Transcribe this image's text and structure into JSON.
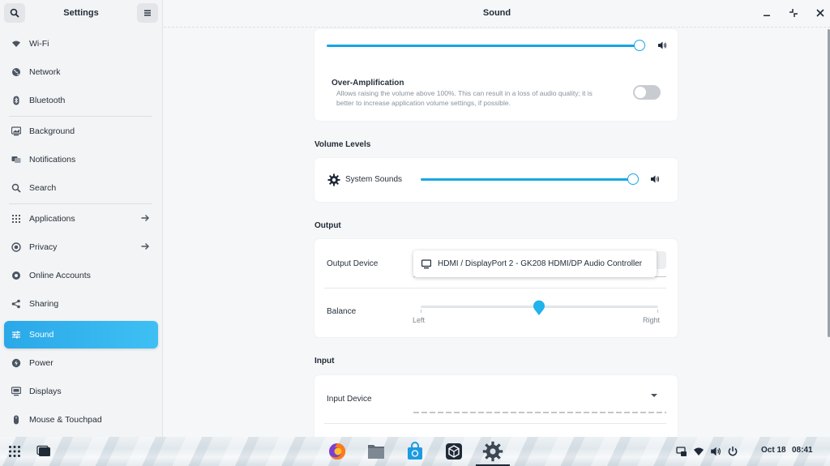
{
  "sidebar": {
    "title": "Settings",
    "items": [
      {
        "label": "Wi-Fi",
        "icon": "wifi-icon"
      },
      {
        "label": "Network",
        "icon": "network-icon"
      },
      {
        "label": "Bluetooth",
        "icon": "bluetooth-icon"
      },
      {
        "label": "Background",
        "icon": "background-icon"
      },
      {
        "label": "Notifications",
        "icon": "notifications-icon"
      },
      {
        "label": "Search",
        "icon": "search-icon"
      },
      {
        "label": "Applications",
        "icon": "applications-icon"
      },
      {
        "label": "Privacy",
        "icon": "privacy-icon"
      },
      {
        "label": "Online Accounts",
        "icon": "online-accounts-icon"
      },
      {
        "label": "Sharing",
        "icon": "share-icon"
      },
      {
        "label": "Sound",
        "icon": "sound-icon",
        "active": true
      },
      {
        "label": "Power",
        "icon": "power-icon"
      },
      {
        "label": "Displays",
        "icon": "displays-icon"
      },
      {
        "label": "Mouse & Touchpad",
        "icon": "mouse-icon"
      }
    ]
  },
  "main": {
    "title": "Sound",
    "output_volume": {
      "level": 1.0
    },
    "over_amplification": {
      "title": "Over-Amplification",
      "description_line1": "Allows raising the volume above 100%. This can result in a loss of audio quality; it is",
      "description_line2": "better to increase application volume settings, if possible.",
      "enabled": false
    },
    "volume_levels": {
      "title": "Volume Levels",
      "system_sounds_label": "System Sounds",
      "system_sounds_level": 1.0
    },
    "output": {
      "title": "Output",
      "device_label": "Output Device",
      "device_value": "HDMI / DisplayPort 2 - GK208 HDMI/DP Audio Controller",
      "balance_label": "Balance",
      "balance_left": "Left",
      "balance_right": "Right",
      "balance_value": 0.5
    },
    "input": {
      "title": "Input",
      "device_label": "Input Device"
    }
  },
  "taskbar": {
    "date": "Oct 18",
    "time": "08:41",
    "apps": [
      "firefox-icon",
      "files-icon",
      "software-store-icon",
      "unity-icon",
      "settings-icon"
    ]
  },
  "colors": {
    "accent": "#17a6e3",
    "sidebar_active": "#2aa8e8",
    "text": "#1f2a38"
  }
}
